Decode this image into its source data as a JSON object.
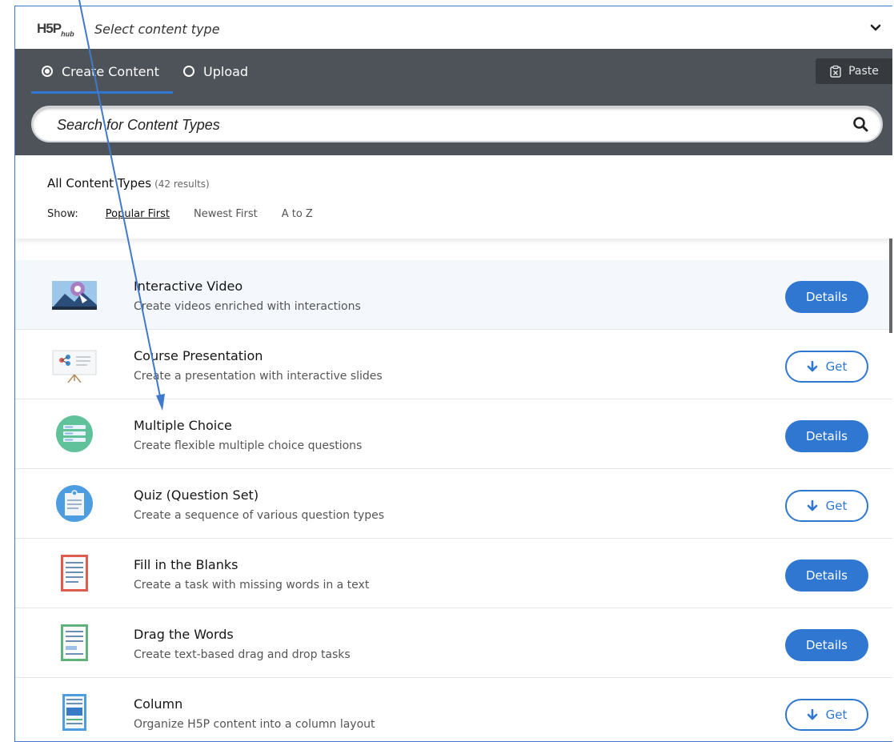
{
  "header": {
    "logo": "H5P",
    "logo_sub": "hub",
    "title": "Select content type"
  },
  "tabs": [
    {
      "label": "Create Content",
      "selected": true
    },
    {
      "label": "Upload",
      "selected": false
    }
  ],
  "paste_label": "Paste",
  "search": {
    "placeholder": "Search for Content Types"
  },
  "list_header": {
    "title": "All Content Types",
    "count": "(42 results)",
    "show_label": "Show:",
    "sort_options": [
      "Popular First",
      "Newest First",
      "A to Z"
    ],
    "active_sort": "Popular First"
  },
  "items": [
    {
      "name": "Interactive Video",
      "desc": "Create videos enriched with interactions",
      "action": "Details",
      "icon": "interactive-video-icon"
    },
    {
      "name": "Course Presentation",
      "desc": "Create a presentation with interactive slides",
      "action": "Get",
      "icon": "course-presentation-icon"
    },
    {
      "name": "Multiple Choice",
      "desc": "Create flexible multiple choice questions",
      "action": "Details",
      "icon": "multiple-choice-icon"
    },
    {
      "name": "Quiz (Question Set)",
      "desc": "Create a sequence of various question types",
      "action": "Get",
      "icon": "quiz-icon"
    },
    {
      "name": "Fill in the Blanks",
      "desc": "Create a task with missing words in a text",
      "action": "Details",
      "icon": "fill-blanks-icon"
    },
    {
      "name": "Drag the Words",
      "desc": "Create text-based drag and drop tasks",
      "action": "Details",
      "icon": "drag-words-icon"
    },
    {
      "name": "Column",
      "desc": "Organize H5P content into a column layout",
      "action": "Get",
      "icon": "column-icon"
    }
  ],
  "colors": {
    "accent": "#2f77d0",
    "tabbar": "#4e5359",
    "annotation": "#3f79c9"
  }
}
